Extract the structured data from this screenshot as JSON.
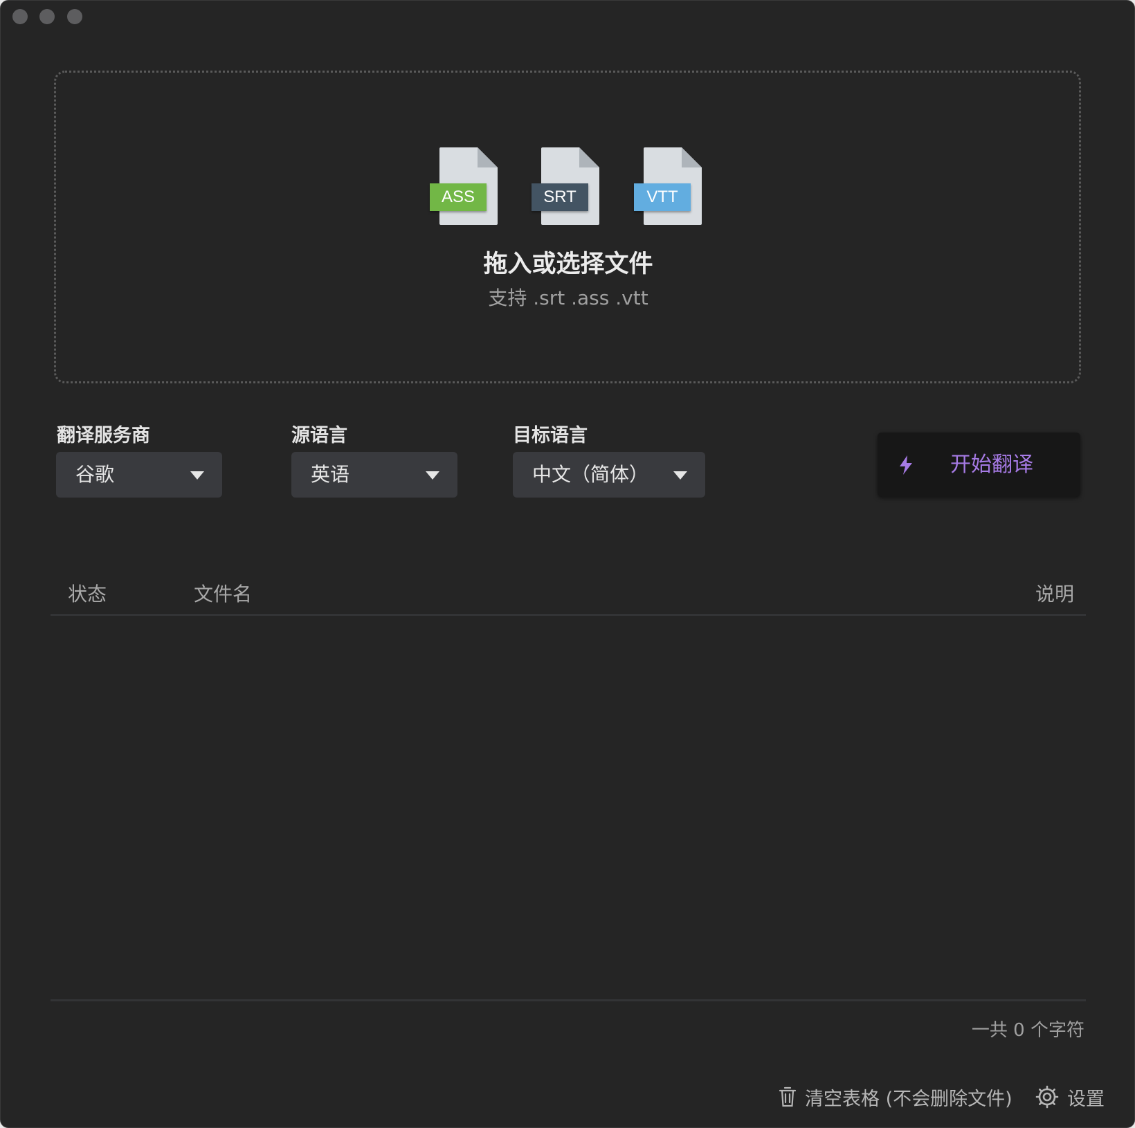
{
  "dropzone": {
    "formats": [
      "ASS",
      "SRT",
      "VTT"
    ],
    "title": "拖入或选择文件",
    "subtitle": "支持 .srt .ass .vtt"
  },
  "controls": {
    "provider_label": "翻译服务商",
    "provider_value": "谷歌",
    "source_label": "源语言",
    "source_value": "英语",
    "target_label": "目标语言",
    "target_value": "中文（简体）",
    "start_label": "开始翻译"
  },
  "table": {
    "columns": [
      "状态",
      "文件名",
      "说明"
    ],
    "rows": []
  },
  "footer": {
    "char_count": "一共 0 个字符",
    "clear_label": "清空表格 (不会删除文件)",
    "settings_label": "设置"
  },
  "colors": {
    "background": "#252525",
    "ass_tag": "#72b746",
    "srt_tag": "#435463",
    "vtt_tag": "#62ade0",
    "accent": "#a77be6"
  },
  "icons": [
    "bolt-icon",
    "trash-icon",
    "gear-icon",
    "file-icon"
  ]
}
